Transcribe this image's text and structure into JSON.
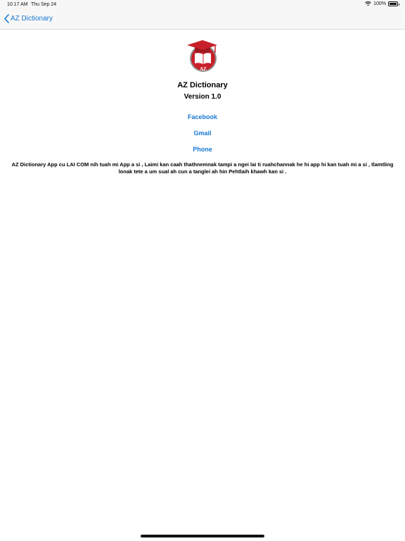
{
  "status_bar": {
    "time": "10:17 AM",
    "date": "Thu Sep 24",
    "battery": "100%"
  },
  "nav": {
    "back_label": "AZ Dictionary"
  },
  "about": {
    "title": "AZ Dictionary",
    "version": "Version 1.0",
    "links": {
      "facebook": "Facebook",
      "gmail": "Gmail",
      "phone": "Phone"
    },
    "description": "AZ Dictionary App cu LAI COM nih tuah mi App a si , Laimi kan caah thathnemnak tampi a ngei lai ti ruahchannak he hi app hi kan tuah mi a si , tlamtling lonak tete a um sual ah cun a tanglei ah hin Pehtlaih khawh kan si ."
  },
  "logo": {
    "text": "AZ"
  },
  "colors": {
    "accent": "#1877d2",
    "logo_red": "#c8202a",
    "nav_background": "#f7f7f7"
  }
}
